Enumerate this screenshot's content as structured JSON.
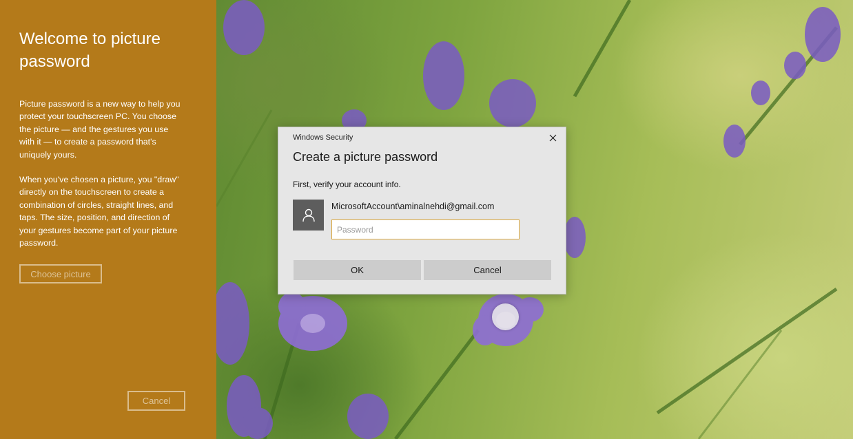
{
  "left_panel": {
    "title": "Welcome to picture password",
    "paragraph1": "Picture password is a new way to help you protect your touchscreen PC. You choose the picture — and the gestures you use with it — to create a password that's uniquely yours.",
    "paragraph2": "When you've chosen a picture, you \"draw\" directly on the touchscreen to create a combination of circles, straight lines, and taps. The size, position, and direction of your gestures become part of your picture password.",
    "choose_picture_label": "Choose picture",
    "cancel_label": "Cancel",
    "background_color": "#b47a1a"
  },
  "dialog": {
    "caption": "Windows Security",
    "close_icon": "close-icon",
    "heading": "Create a picture password",
    "subtitle": "First, verify your account info.",
    "avatar_icon": "user-icon",
    "account": "MicrosoftAccount\\aminalnehdi@gmail.com",
    "password_value": "",
    "password_placeholder": "Password",
    "ok_label": "OK",
    "cancel_label": "Cancel",
    "input_border_color": "#d9a53a"
  },
  "background": {
    "description_icon": "lavander-photo"
  }
}
